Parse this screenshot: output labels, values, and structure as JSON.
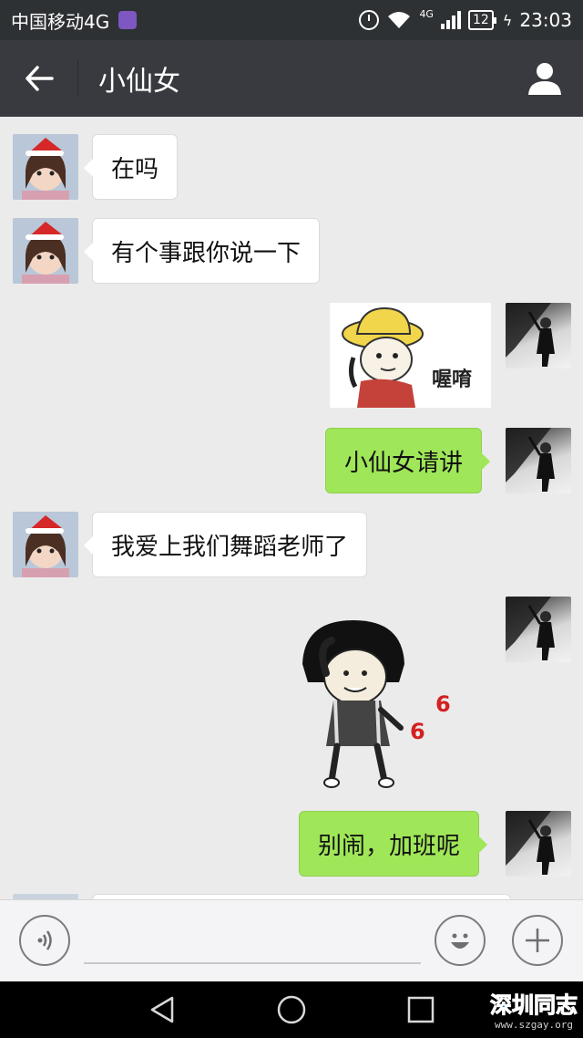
{
  "status_bar": {
    "carrier": "中国移动4G",
    "network_type": "4G",
    "battery": "12",
    "time": "23:03"
  },
  "header": {
    "title": "小仙女",
    "back_icon": "arrow-left-icon",
    "profile_icon": "person-icon"
  },
  "messages": [
    {
      "side": "left",
      "type": "text",
      "text": "在吗"
    },
    {
      "side": "left",
      "type": "text",
      "text": "有个事跟你说一下"
    },
    {
      "side": "right",
      "type": "sticker",
      "caption": "喔唷"
    },
    {
      "side": "right",
      "type": "text",
      "text": "小仙女请讲"
    },
    {
      "side": "left",
      "type": "text",
      "text": "我爱上我们舞蹈老师了"
    },
    {
      "side": "right",
      "type": "sticker",
      "caption_top": "6",
      "caption_bottom": "6"
    },
    {
      "side": "right",
      "type": "text",
      "text": "别闹，加班呢"
    }
  ],
  "input_bar": {
    "voice_icon": "voice-icon",
    "emoji_icon": "emoji-icon",
    "plus_icon": "plus-icon",
    "value": ""
  },
  "watermark": {
    "main": "深圳同志",
    "sub": "www.szgay.org"
  },
  "colors": {
    "status_bar_bg": "#2e3133",
    "title_bar_bg": "#393a3f",
    "chat_bg": "#ebebeb",
    "sent_bubble": "#9fe658",
    "received_bubble": "#ffffff"
  }
}
